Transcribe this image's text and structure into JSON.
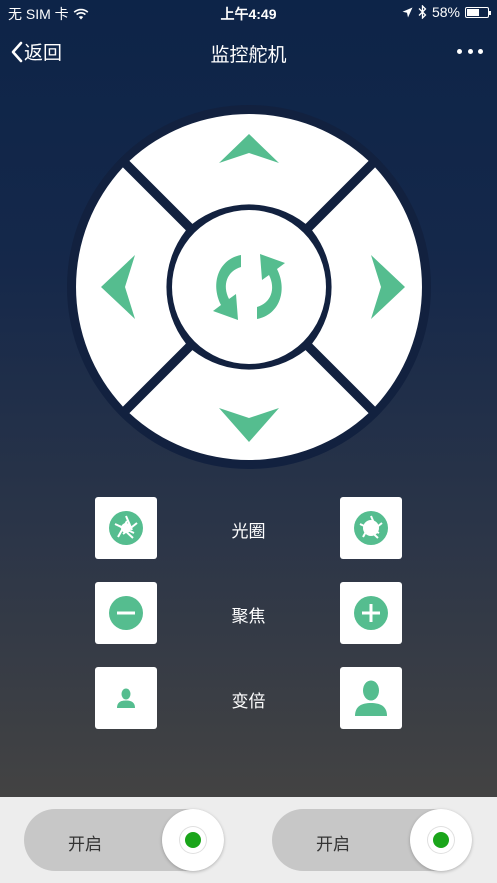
{
  "status_bar": {
    "carrier": "无 SIM 卡",
    "time": "上午4:49",
    "battery": "58%",
    "icons": [
      "wifi-icon",
      "location-arrow-icon",
      "bluetooth-icon",
      "battery-icon"
    ]
  },
  "nav": {
    "back_label": "返回",
    "title": "监控舵机",
    "icons": [
      "chevron-left-icon",
      "more-icon"
    ]
  },
  "dpad": {
    "icons": [
      "arrow-up-icon",
      "arrow-down-icon",
      "arrow-left-icon",
      "arrow-right-icon",
      "refresh-icon"
    ]
  },
  "controls": [
    {
      "label": "光圈",
      "left_icon": "aperture-icon",
      "right_icon": "aperture-icon"
    },
    {
      "label": "聚焦",
      "left_icon": "minus-icon",
      "right_icon": "plus-icon"
    },
    {
      "label": "变倍",
      "left_icon": "person-small-icon",
      "right_icon": "person-large-icon"
    }
  ],
  "toggles": [
    {
      "label": "开启",
      "on": true
    },
    {
      "label": "开启",
      "on": true
    }
  ],
  "colors": {
    "accent": "#55bd8f",
    "ring": "#12213f",
    "toggle_on": "#1aa51a",
    "bottom_bar": "#ededed"
  }
}
